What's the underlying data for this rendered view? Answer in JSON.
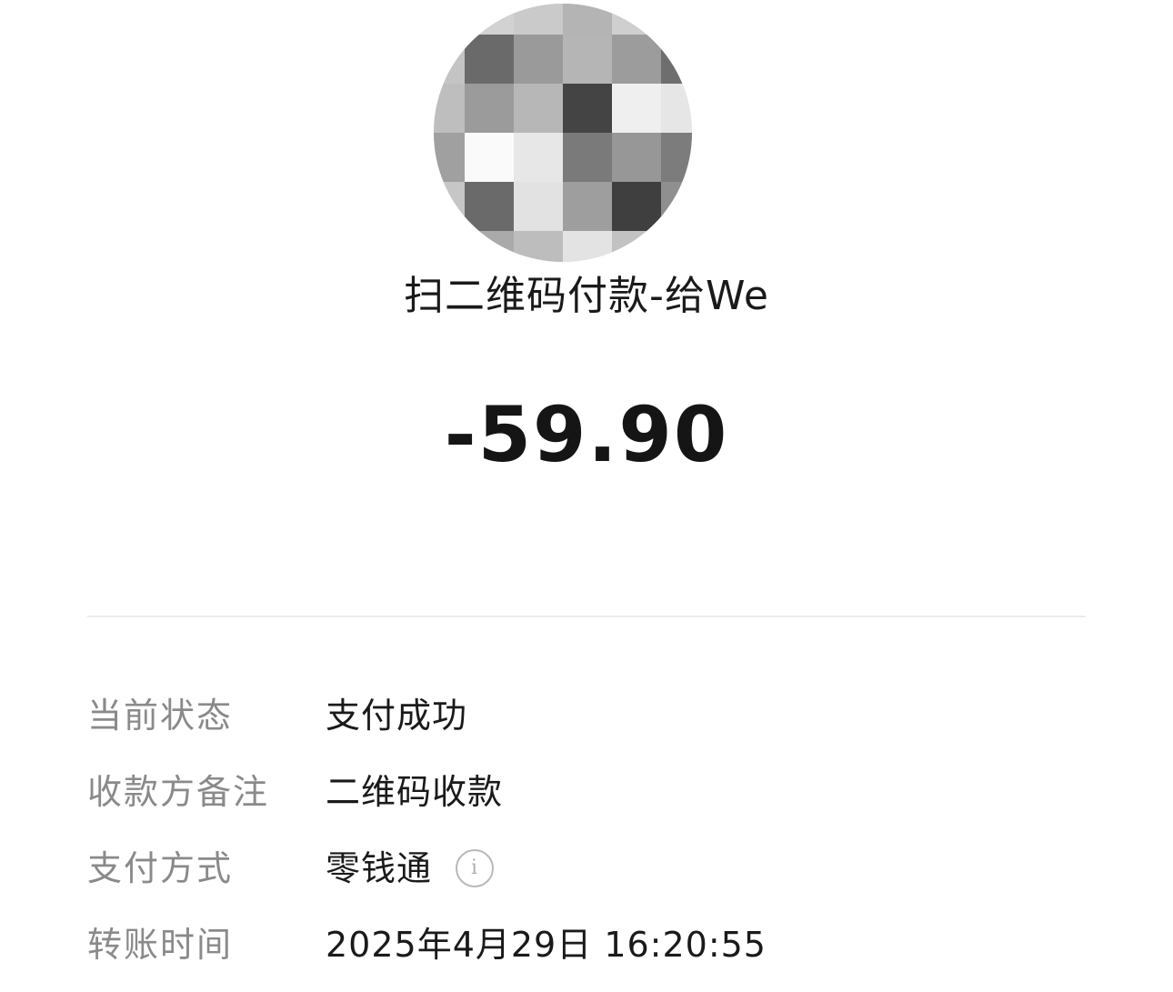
{
  "header": {
    "title": "扫二维码付款-给We",
    "amount": "-59.90"
  },
  "avatar": {
    "icon": "pixelated-avatar",
    "tiles": [
      "#cfcfcf",
      "#d2d2d2",
      "#cacaca",
      "#b4b4b4",
      "#cfcfcf",
      "#c9c9c9",
      "#c4c4c4",
      "#6a6a6a",
      "#9a9a9a",
      "#b5b5b5",
      "#9c9c9c",
      "#6e6e6e",
      "#bebebe",
      "#9b9b9b",
      "#b7b7b7",
      "#444444",
      "#efefef",
      "#e6e6e6",
      "#a0a0a0",
      "#fafafa",
      "#e7e7e7",
      "#7a7a7a",
      "#979797",
      "#7c7c7c",
      "#c6c6c6",
      "#6a6a6a",
      "#e2e2e2",
      "#9e9e9e",
      "#3f3f3f",
      "#8f8f8f",
      "#c9c9c9",
      "#aaaaaa",
      "#bdbdbd",
      "#e3e3e3",
      "#c2c2c2",
      "#d0d0d0"
    ]
  },
  "details": {
    "rows": [
      {
        "label": "当前状态",
        "value": "支付成功"
      },
      {
        "label": "收款方备注",
        "value": "二维码收款"
      },
      {
        "label": "支付方式",
        "value": "零钱通",
        "icon": "info-icon"
      },
      {
        "label": "转账时间",
        "value": "2025年4月29日 16:20:55"
      }
    ]
  }
}
